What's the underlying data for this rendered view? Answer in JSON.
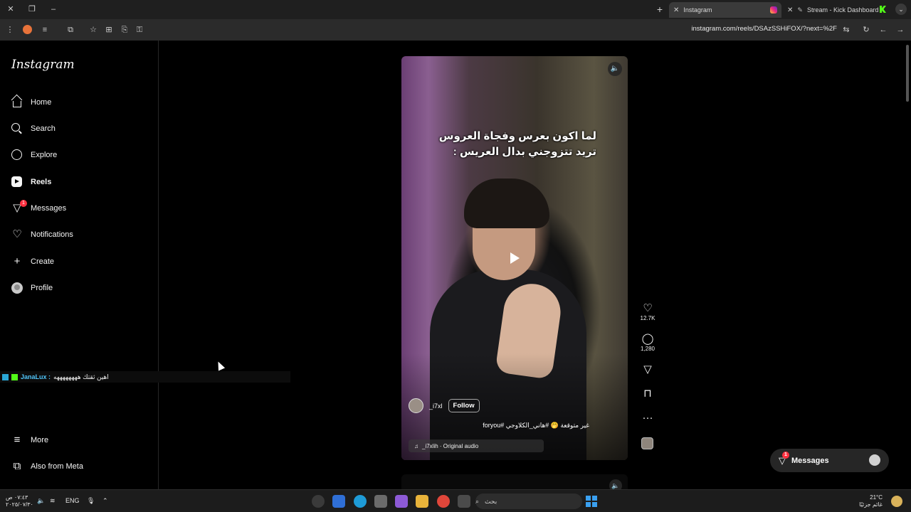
{
  "browser": {
    "tabs": [
      {
        "title": "Instagram",
        "active": true
      },
      {
        "title": "Stream - Kick Dashboard",
        "active": false
      }
    ],
    "url": "instagram.com/reels/DSAzSSHiFOX/?next=%2F",
    "new_tab_icon": "plus-icon"
  },
  "sidebar": {
    "logo": "Instagram",
    "items": [
      {
        "label": "Home",
        "icon": "home-icon"
      },
      {
        "label": "Search",
        "icon": "search-icon"
      },
      {
        "label": "Explore",
        "icon": "compass-icon"
      },
      {
        "label": "Reels",
        "icon": "reels-icon"
      },
      {
        "label": "Messages",
        "icon": "messenger-icon",
        "badge": "1"
      },
      {
        "label": "Notifications",
        "icon": "heart-icon"
      },
      {
        "label": "Create",
        "icon": "plus-icon"
      },
      {
        "label": "Profile",
        "icon": "avatar-icon"
      }
    ],
    "more": "More",
    "meta": "Also from Meta"
  },
  "chat": {
    "user": "JanaLux :",
    "message": "اهين ثقتك ههههههههه"
  },
  "reel": {
    "caption_line1": "لما اكون بعرس وفجاة العروس",
    "caption_line2": "تريد تتزوجني بدال العريس :",
    "author": "_i7xl",
    "follow_label": "Follow",
    "description": "غير متوقعة 🤭 #هاني_الكلاوجي #foryou",
    "audio": "_i7xlih · Original audio",
    "likes": "12.7K",
    "comments": "1,280"
  },
  "messages_pill": {
    "label": "Messages",
    "badge": "1"
  },
  "taskbar": {
    "time": "٠٧:٤٣ ص",
    "date": "٢٠٢٥/٠٧/٣٠",
    "lang": "ENG",
    "search_placeholder": "بحث",
    "weather_temp": "21°C",
    "weather_text": "غائم جزئيًا"
  },
  "colors": {
    "accent_red": "#ff3040",
    "background": "#000000",
    "chat_user": "#4fc3f7"
  }
}
